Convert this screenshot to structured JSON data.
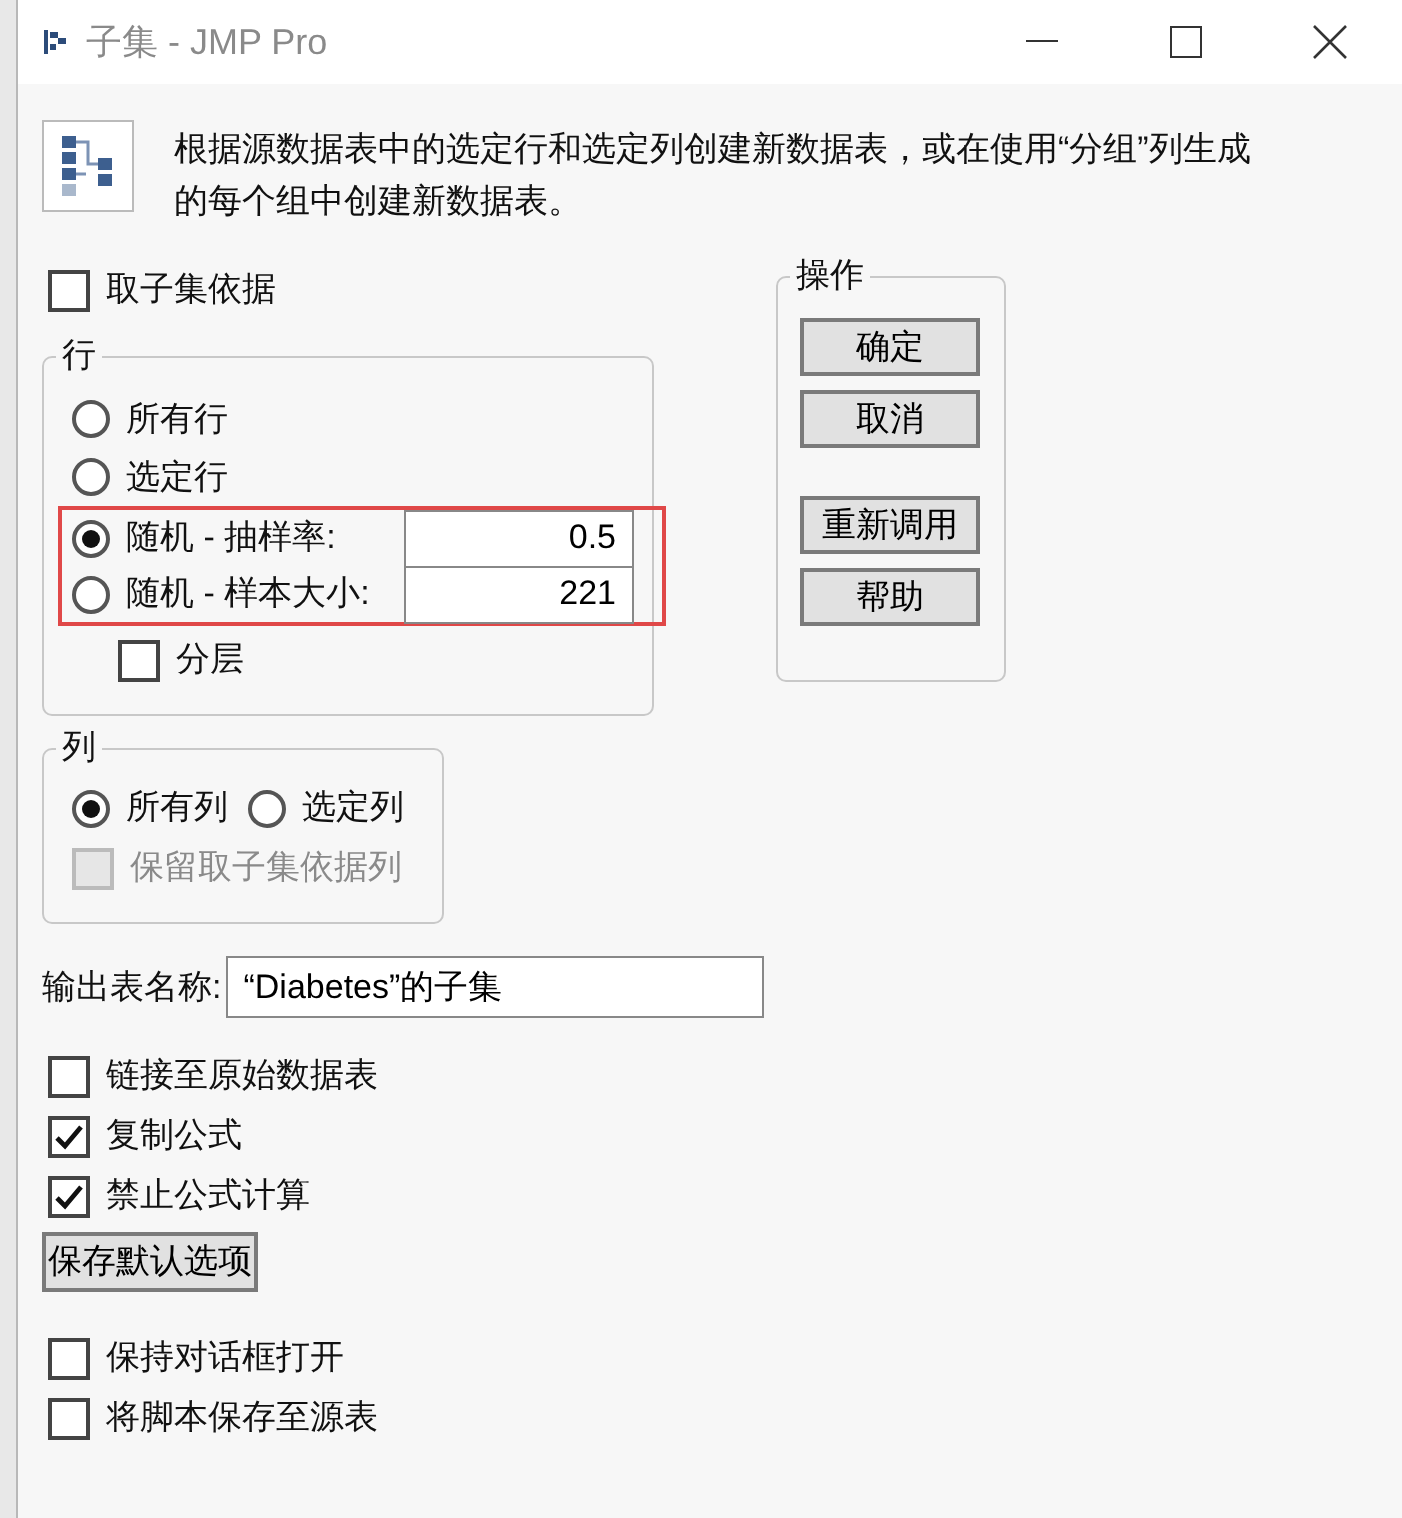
{
  "window": {
    "title": "子集 - JMP Pro"
  },
  "description": "根据源数据表中的选定行和选定列创建新数据表，或在使用“分组”列生成的每个组中创建新数据表。",
  "subset_by": {
    "label": "取子集依据",
    "checked": false
  },
  "rows_group": {
    "title": "行",
    "options": [
      {
        "kind": "radio",
        "label": "所有行",
        "selected": false,
        "highlighted": false
      },
      {
        "kind": "radio",
        "label": "选定行",
        "selected": false,
        "highlighted": false
      },
      {
        "kind": "radio_field",
        "label": "随机 - 抽样率:",
        "value": "0.5",
        "selected": true,
        "highlighted": true
      },
      {
        "kind": "radio_field",
        "label": "随机 - 样本大小:",
        "value": "221",
        "selected": false,
        "highlighted": true
      }
    ],
    "stratify": {
      "label": "分层",
      "checked": false
    }
  },
  "actions": {
    "title": "操作",
    "button_groups": [
      [
        "确定",
        "取消"
      ],
      [
        "重新调用",
        "帮助"
      ]
    ]
  },
  "columns_group": {
    "title": "列",
    "options": [
      {
        "label": "所有列",
        "selected": true
      },
      {
        "label": "选定列",
        "selected": false
      }
    ],
    "keep_column": {
      "label": "保留取子集依据列",
      "checked": false,
      "disabled": true
    }
  },
  "output_table_name": {
    "label": "输出表名称:",
    "value": "“Diabetes”的子集"
  },
  "options": [
    {
      "label": "链接至原始数据表",
      "checked": false
    },
    {
      "label": "复制公式",
      "checked": true
    },
    {
      "label": "禁止公式计算",
      "checked": true
    }
  ],
  "save_defaults_button": "保存默认选项",
  "dialog_options": [
    {
      "label": "保持对话框打开",
      "checked": false
    },
    {
      "label": "将脚本保存至源表",
      "checked": false
    }
  ]
}
